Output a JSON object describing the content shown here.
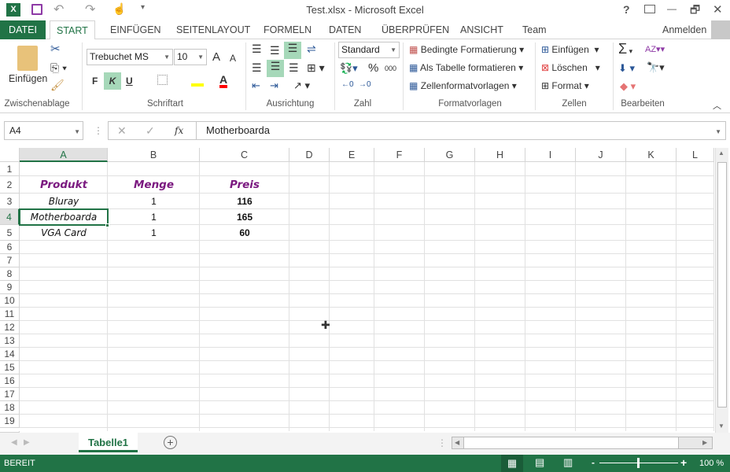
{
  "window": {
    "title": "Test.xlsx - Microsoft Excel",
    "help": "?",
    "minimize": "—",
    "restore": "🗗",
    "close": "✕"
  },
  "tabs": [
    {
      "label": "DATEI"
    },
    {
      "label": "START"
    },
    {
      "label": "EINFÜGEN"
    },
    {
      "label": "SEITENLAYOUT"
    },
    {
      "label": "FORMELN"
    },
    {
      "label": "DATEN"
    },
    {
      "label": "ÜBERPRÜFEN"
    },
    {
      "label": "ANSICHT"
    },
    {
      "label": "Team"
    }
  ],
  "account": {
    "signin": "Anmelden"
  },
  "ribbon": {
    "clipboard": {
      "label": "Zwischenablage",
      "paste": "Einfügen"
    },
    "font": {
      "label": "Schriftart",
      "name": "Trebuchet MS",
      "size": "10",
      "bold": "F",
      "italic": "K",
      "underline": "U",
      "grow": "A",
      "shrink": "A",
      "color": "A"
    },
    "alignment": {
      "label": "Ausrichtung"
    },
    "number": {
      "label": "Zahl",
      "format": "Standard",
      "percent": "%",
      "thousands": "000"
    },
    "styles": {
      "label": "Formatvorlagen",
      "conditional": "Bedingte Formatierung",
      "table": "Als Tabelle formatieren",
      "cell": "Zellenformatvorlagen"
    },
    "cells": {
      "label": "Zellen",
      "insert": "Einfügen",
      "delete": "Löschen",
      "format": "Format"
    },
    "editing": {
      "label": "Bearbeiten",
      "sum": "Σ"
    },
    "colors": {
      "fill": "#ffff00",
      "font": "#ff0000"
    }
  },
  "formula_bar": {
    "name_box": "A4",
    "fx": "fx",
    "value": "Motherboarda"
  },
  "sheet": {
    "columns": [
      "A",
      "B",
      "C",
      "D",
      "E",
      "F",
      "G",
      "H",
      "I",
      "J",
      "K",
      "L"
    ],
    "rows": [
      "1",
      "2",
      "3",
      "4",
      "5",
      "6",
      "7",
      "8",
      "9",
      "10",
      "11",
      "12",
      "13",
      "14",
      "15",
      "16",
      "17",
      "18",
      "19"
    ],
    "selected": "A4",
    "cells": {
      "A2": "Produkt",
      "B2": "Menge",
      "C2": "Preis",
      "A3": "Bluray",
      "B3": "1",
      "C3": "116",
      "A4": "Motherboarda",
      "B4": "1",
      "C4": "165",
      "A5": "VGA Card",
      "B5": "1",
      "C5": "60"
    }
  },
  "sheet_tabs": [
    {
      "label": "Tabelle1",
      "active": true
    }
  ],
  "status": {
    "text": "BEREIT",
    "zoom": "100 %",
    "zoom_minus": "-",
    "zoom_plus": "+"
  },
  "accent": "#217346"
}
